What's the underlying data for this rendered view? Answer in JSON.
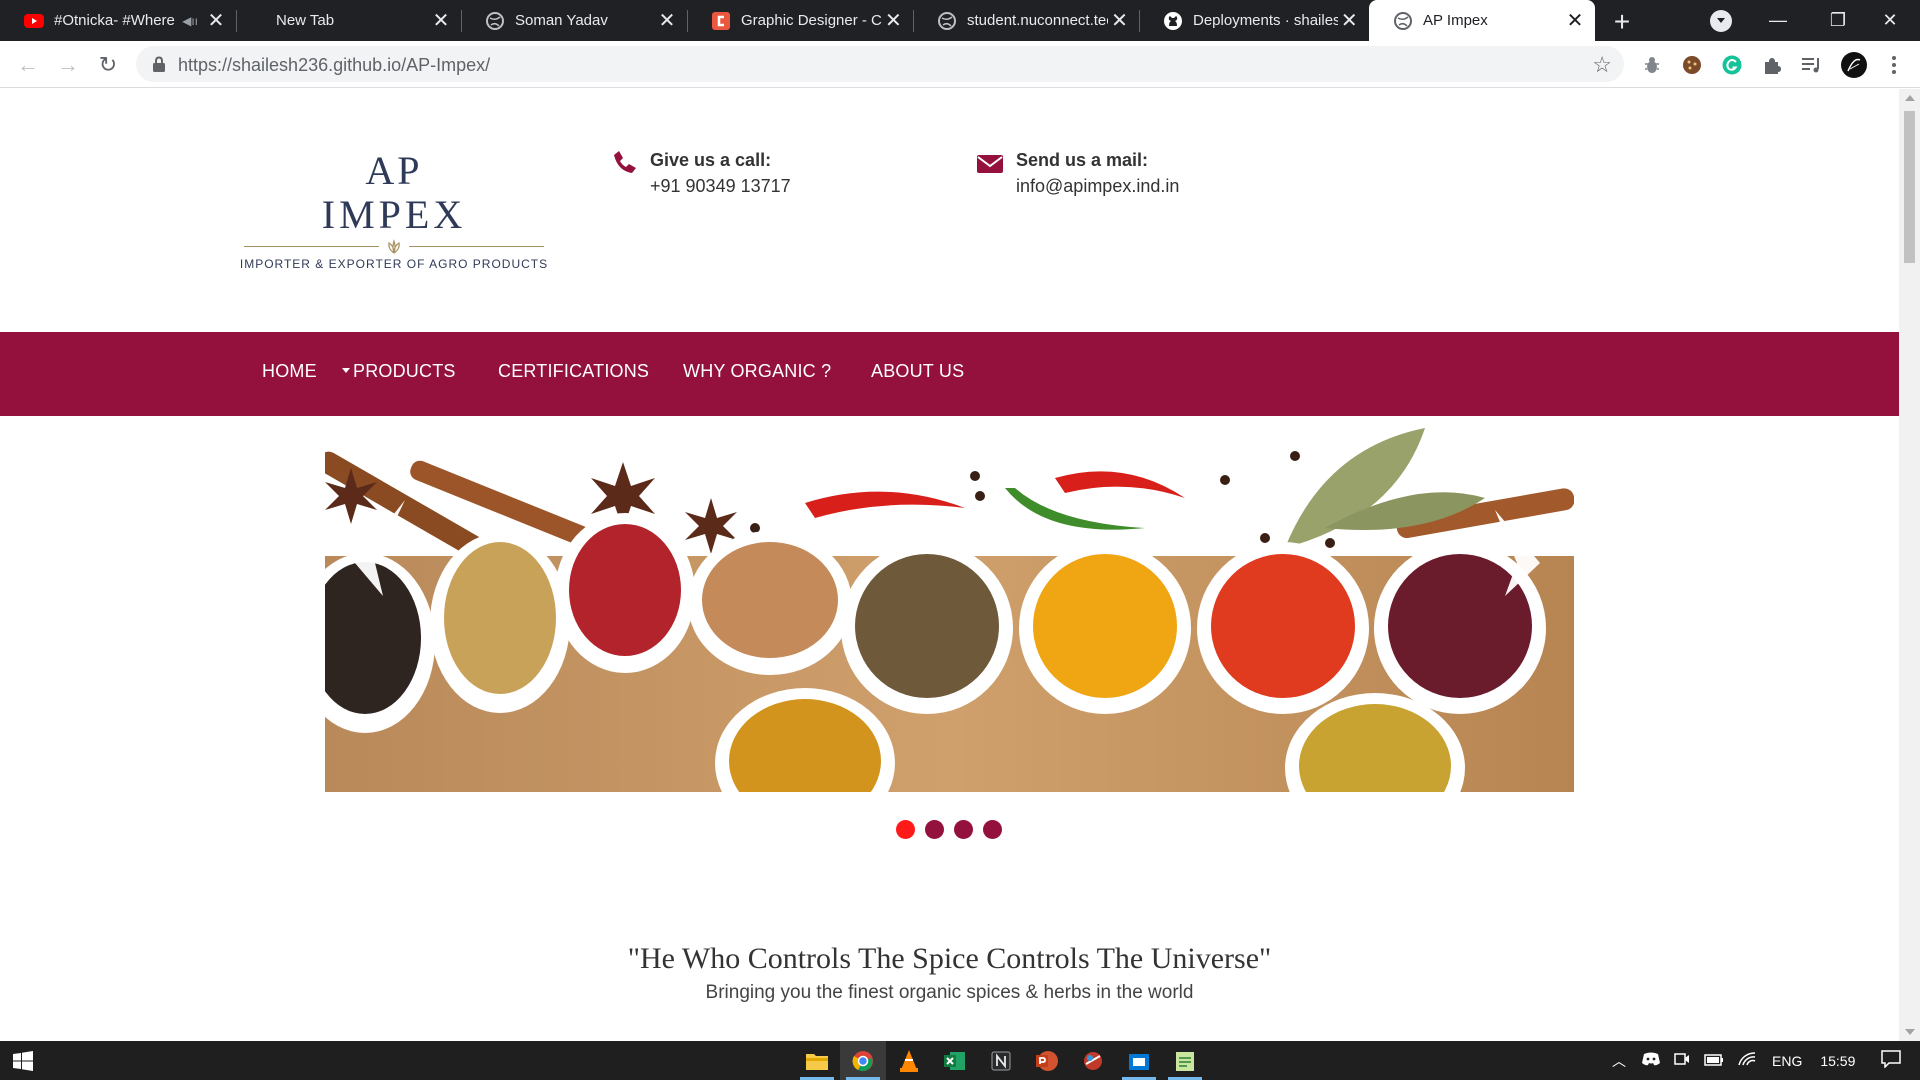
{
  "browser": {
    "tabs": [
      {
        "title": "#Otnicka- #Where",
        "icon": "youtube-icon",
        "muted_icon": "speaker-muted-icon"
      },
      {
        "title": "New Tab",
        "icon": "none"
      },
      {
        "title": "Soman Yadav",
        "icon": "globe-icon"
      },
      {
        "title": "Graphic Designer - Cr",
        "icon": "coursera-like-icon"
      },
      {
        "title": "student.nuconnect.tec",
        "icon": "globe-icon"
      },
      {
        "title": "Deployments · shailes",
        "icon": "github-icon"
      },
      {
        "title": "AP Impex",
        "icon": "globe-icon",
        "active": true
      }
    ],
    "url_host": "https://shailesh236.github.io",
    "url_path": "/AP-Impex/"
  },
  "site": {
    "logo": {
      "line1": "AP",
      "line2": "IMPEX",
      "tagline": "IMPORTER & EXPORTER OF AGRO PRODUCTS"
    },
    "call": {
      "label": "Give us a call:",
      "value": "+91 90349 13717"
    },
    "mail": {
      "label": "Send us a mail:",
      "value": "info@apimpex.ind.in"
    },
    "menu": {
      "home": "HOME",
      "products": "PRODUCTS",
      "certifications": "CERTIFICATIONS",
      "why_organic": "WHY ORGANIC ?",
      "about": "ABOUT US"
    },
    "slider": {
      "slide_count": 4,
      "active_slide": 1
    },
    "quote": "\"He Who Controls The Spice Controls The Universe\"",
    "subquote": "Bringing you the finest organic spices & herbs in the world",
    "colors": {
      "brand": "#94113d",
      "dot_active": "#ff1a1a"
    }
  },
  "taskbar": {
    "lang": "ENG",
    "time": "15:59"
  }
}
